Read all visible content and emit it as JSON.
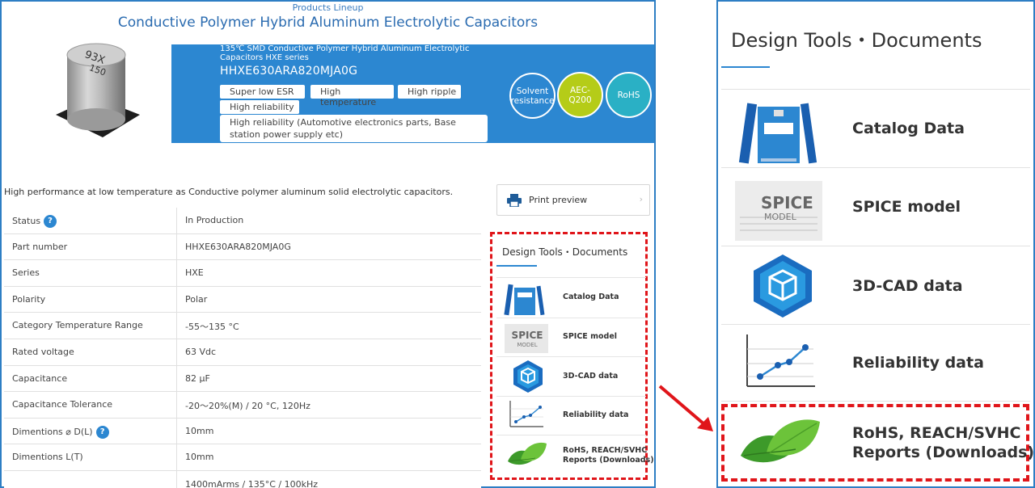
{
  "product_page": {
    "lineup_label": "Products Lineup",
    "title": "Conductive Polymer Hybrid Aluminum Electrolytic Capacitors",
    "series_description": "135℃ SMD Conductive Polymer Hybrid Aluminum Electrolytic Capacitors HXE series",
    "part_number": "HHXE630ARA820MJA0G",
    "tags": [
      "Super low ESR",
      "High temperature",
      "High ripple",
      "High reliability"
    ],
    "long_tag": "High reliability (Automotive electronics parts, Base station power supply etc)",
    "badges": [
      {
        "label": "Solvent resistance",
        "color": "#2c87d1"
      },
      {
        "label": "AEC-Q200",
        "color": "#b5cc18"
      },
      {
        "label": "RoHS",
        "color": "#2ab0c5"
      }
    ],
    "summary": "High performance at low temperature as Conductive polymer aluminum solid electrolytic capacitors.",
    "specs": [
      {
        "key": "Status",
        "value": "In Production",
        "help": "?"
      },
      {
        "key": "Part number",
        "value": "HHXE630ARA820MJA0G"
      },
      {
        "key": "Series",
        "value": "HXE"
      },
      {
        "key": "Polarity",
        "value": "Polar"
      },
      {
        "key": "Category Temperature Range",
        "value": "-55～135 °C"
      },
      {
        "key": "Rated voltage",
        "value": "63 Vdc"
      },
      {
        "key": "Capacitance",
        "value": "82 μF"
      },
      {
        "key": "Capacitance Tolerance",
        "value": "-20～20%(M) / 20 °C, 120Hz"
      },
      {
        "key": "Dimentions ⌀ D(L)",
        "value": "10mm",
        "help": "?"
      },
      {
        "key": "Dimentions L(T)",
        "value": "10mm"
      },
      {
        "key": "",
        "value": "1400mArms / 135°C / 100kHz"
      }
    ],
    "print_preview": "Print preview"
  },
  "design_tools": {
    "title": "Design Tools・Documents",
    "items": [
      {
        "label": "Catalog Data",
        "icon": "catalog-icon"
      },
      {
        "label": "SPICE model",
        "icon": "spice-model-icon"
      },
      {
        "label": "3D-CAD data",
        "icon": "3d-cad-icon"
      },
      {
        "label": "Reliability data",
        "icon": "reliability-chart-icon"
      },
      {
        "label_line1": "RoHS, REACH/SVHC",
        "label_line2": "Reports (Downloads)",
        "icon": "leaf-icon"
      }
    ]
  },
  "colors": {
    "brand_blue": "#2c87d1",
    "highlight_red": "#e0151a",
    "leaf_green": "#4caf2a"
  }
}
